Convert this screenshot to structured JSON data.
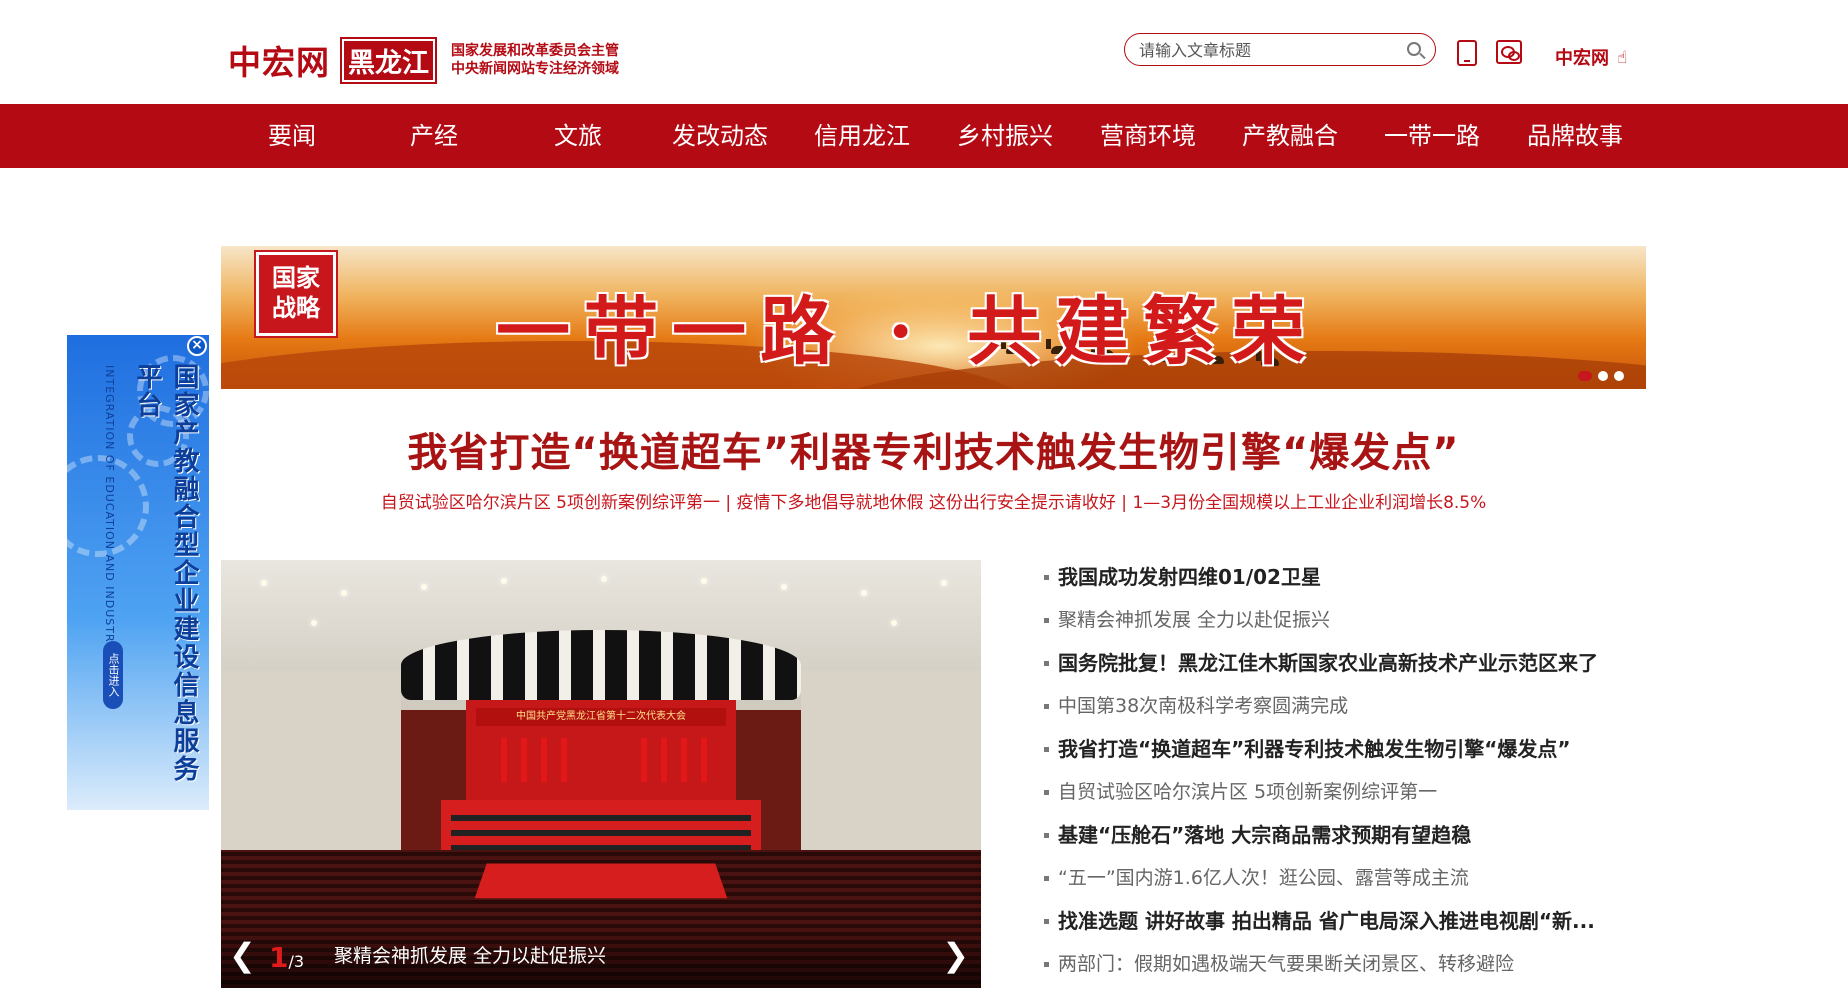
{
  "header": {
    "logo_main": "中宏网",
    "logo_region": "黑龙江",
    "logo_sub_line1": "国家发展和改革委员会主管",
    "logo_sub_line2": "中央新闻网站专注经济领域",
    "search_placeholder": "请输入文章标题",
    "right_link": "中宏网",
    "icons": [
      "search-icon",
      "phone-icon",
      "wechat-icon",
      "hand-pointer-icon"
    ]
  },
  "nav": {
    "items": [
      "要闻",
      "产经",
      "文旅",
      "发改动态",
      "信用龙江",
      "乡村振兴",
      "营商环境",
      "产教融合",
      "一带一路",
      "品牌故事"
    ]
  },
  "banner": {
    "seal_line1": "国家",
    "seal_line2": "战略",
    "title": "一带一路 · 共建繁荣",
    "slides": 3,
    "active_slide": 1
  },
  "headline": {
    "title": "我省打造“换道超车”利器专利技术触发生物引擎“爆发点”",
    "subheads": [
      "自贸试验区哈尔滨片区 5项创新案例综评第一",
      "疫情下多地倡导就地休假 这份出行安全提示请收好",
      "1—3月份全国规模以上工业企业利润增长8.5%"
    ],
    "separator": " | "
  },
  "slider": {
    "caption": "聚精会神抓发展 全力以赴促振兴",
    "current": "1",
    "total": "/3",
    "stage_banner": "中国共产党黑龙江省第十二次代表大会",
    "prev": "❮",
    "next": "❯"
  },
  "news": {
    "items": [
      {
        "title": "我国成功发射四维01/02卫星",
        "bold": true
      },
      {
        "title": "聚精会神抓发展 全力以赴促振兴",
        "bold": false
      },
      {
        "title": "国务院批复！黑龙江佳木斯国家农业高新技术产业示范区来了",
        "bold": true
      },
      {
        "title": "中国第38次南极科学考察圆满完成",
        "bold": false
      },
      {
        "title": "我省打造“换道超车”利器专利技术触发生物引擎“爆发点”",
        "bold": true
      },
      {
        "title": "自贸试验区哈尔滨片区 5项创新案例综评第一",
        "bold": false
      },
      {
        "title": "基建“压舱石”落地 大宗商品需求预期有望趋稳",
        "bold": true
      },
      {
        "title": "“五一”国内游1.6亿人次！逛公园、露营等成主流",
        "bold": false
      },
      {
        "title": "找准选题 讲好故事 拍出精品 省广电局深入推进电视剧“新...",
        "bold": true
      },
      {
        "title": "两部门：假期如遇极端天气要果断关闭景区、转移避险",
        "bold": false
      }
    ]
  },
  "side_ad": {
    "title": "国家产教融合型企业建设信息服务平台",
    "subtitle": "INTEGRATION OF EDUCATION AND INDUSTRY",
    "button": "点击进入",
    "close": "×"
  },
  "colors": {
    "brand_red": "#b40a14",
    "nav_bg": "#b40a14",
    "headline_red": "#a81414",
    "ad_blue": "#1f6ee0"
  }
}
